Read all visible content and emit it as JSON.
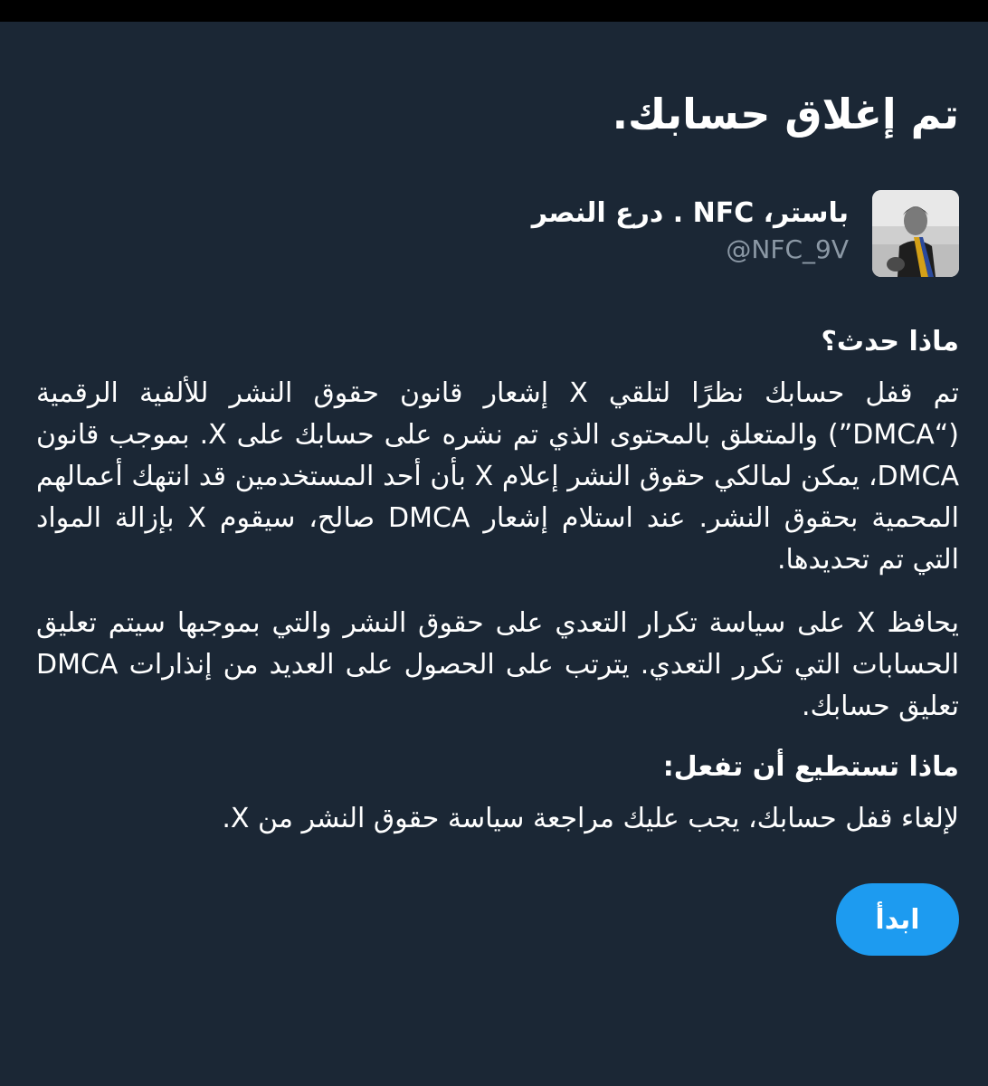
{
  "page": {
    "title": "تم إغلاق حسابك."
  },
  "profile": {
    "display_name": "باستر، NFC . درع النصر",
    "handle": "@NFC_9V"
  },
  "what_happened": {
    "heading": "ماذا حدث؟",
    "paragraph_1": "تم قفل حسابك نظرًا لتلقي X إشعار قانون حقوق النشر للألفية الرقمية (“DMCA”) والمتعلق بالمحتوى الذي تم نشره على حسابك على X. بموجب قانون DMCA، يمكن لمالكي حقوق النشر إعلام X بأن أحد المستخدمين قد انتهك أعمالهم المحمية بحقوق النشر. عند استلام إشعار DMCA صالح، سيقوم X بإزالة المواد التي تم تحديدها.",
    "paragraph_2": "يحافظ X على سياسة تكرار التعدي على حقوق النشر والتي بموجبها سيتم تعليق الحسابات التي تكرر التعدي. يترتب على الحصول على العديد من إنذارات DMCA تعليق حسابك."
  },
  "what_to_do": {
    "heading": "ماذا تستطيع أن تفعل:",
    "paragraph": "لإلغاء قفل حسابك، يجب عليك مراجعة سياسة حقوق النشر من X."
  },
  "actions": {
    "start_label": "ابدأ"
  },
  "colors": {
    "background": "#1b2735",
    "accent": "#1d9bf0",
    "secondary_text": "#8b98a5"
  },
  "icons": {
    "avatar": "profile-photo"
  }
}
